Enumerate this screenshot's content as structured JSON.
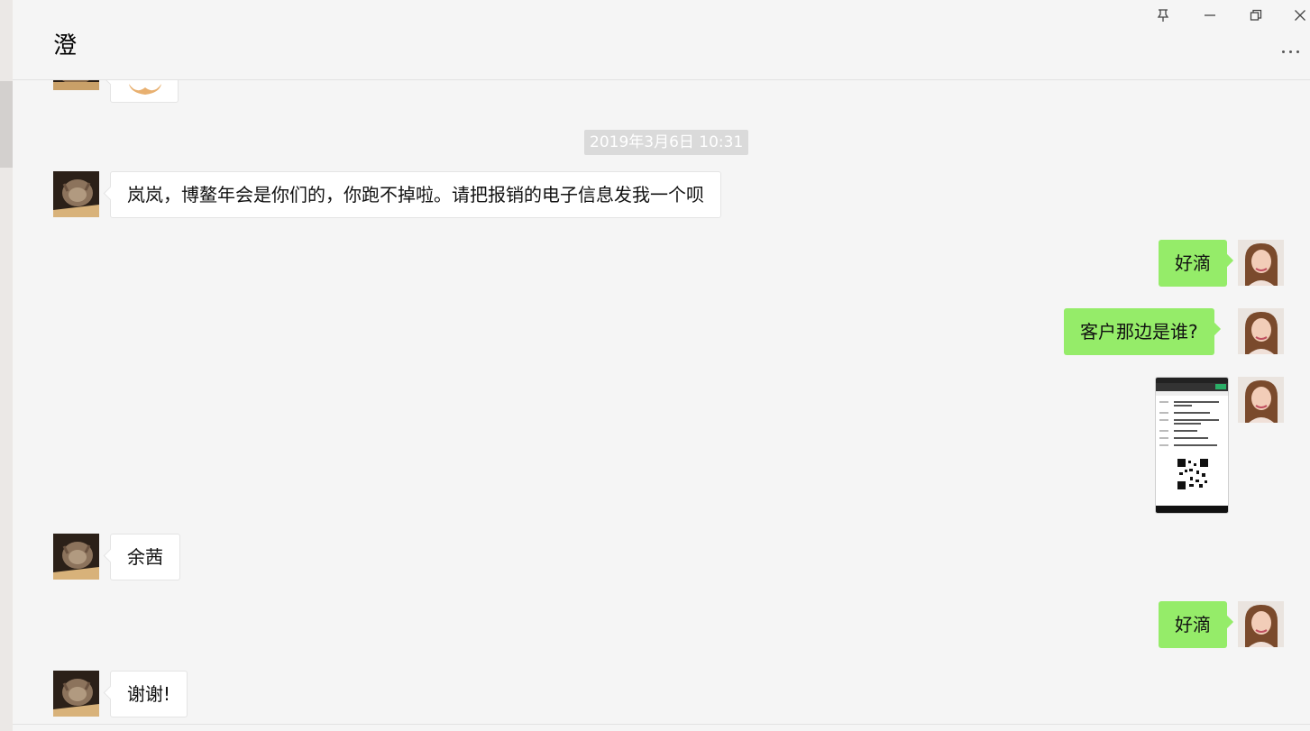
{
  "window": {
    "title": "澄",
    "controls": [
      "pin-icon",
      "minimize-icon",
      "restore-icon",
      "close-icon"
    ],
    "more_icon": "more-dots-icon"
  },
  "chat": {
    "timestamp": "2019年3月6日 10:31",
    "messages": [
      {
        "sender": "contact",
        "type": "image-partial"
      },
      {
        "sender": "contact",
        "type": "text",
        "text": "岚岚，博鳌年会是你们的，你跑不掉啦。请把报销的电子信息发我一个呗"
      },
      {
        "sender": "me",
        "type": "text",
        "text": "好滴"
      },
      {
        "sender": "me",
        "type": "text",
        "text": "客户那边是谁?"
      },
      {
        "sender": "me",
        "type": "image",
        "icon": "invoice-screenshot-image"
      },
      {
        "sender": "contact",
        "type": "text",
        "text": "余茜"
      },
      {
        "sender": "me",
        "type": "text",
        "text": "好滴"
      },
      {
        "sender": "contact",
        "type": "text",
        "text": "谢谢!"
      }
    ]
  },
  "colors": {
    "background": "#f5f5f5",
    "bubble_in": "#ffffff",
    "bubble_out": "#95ec69",
    "timestamp_bg": "#dadada"
  }
}
